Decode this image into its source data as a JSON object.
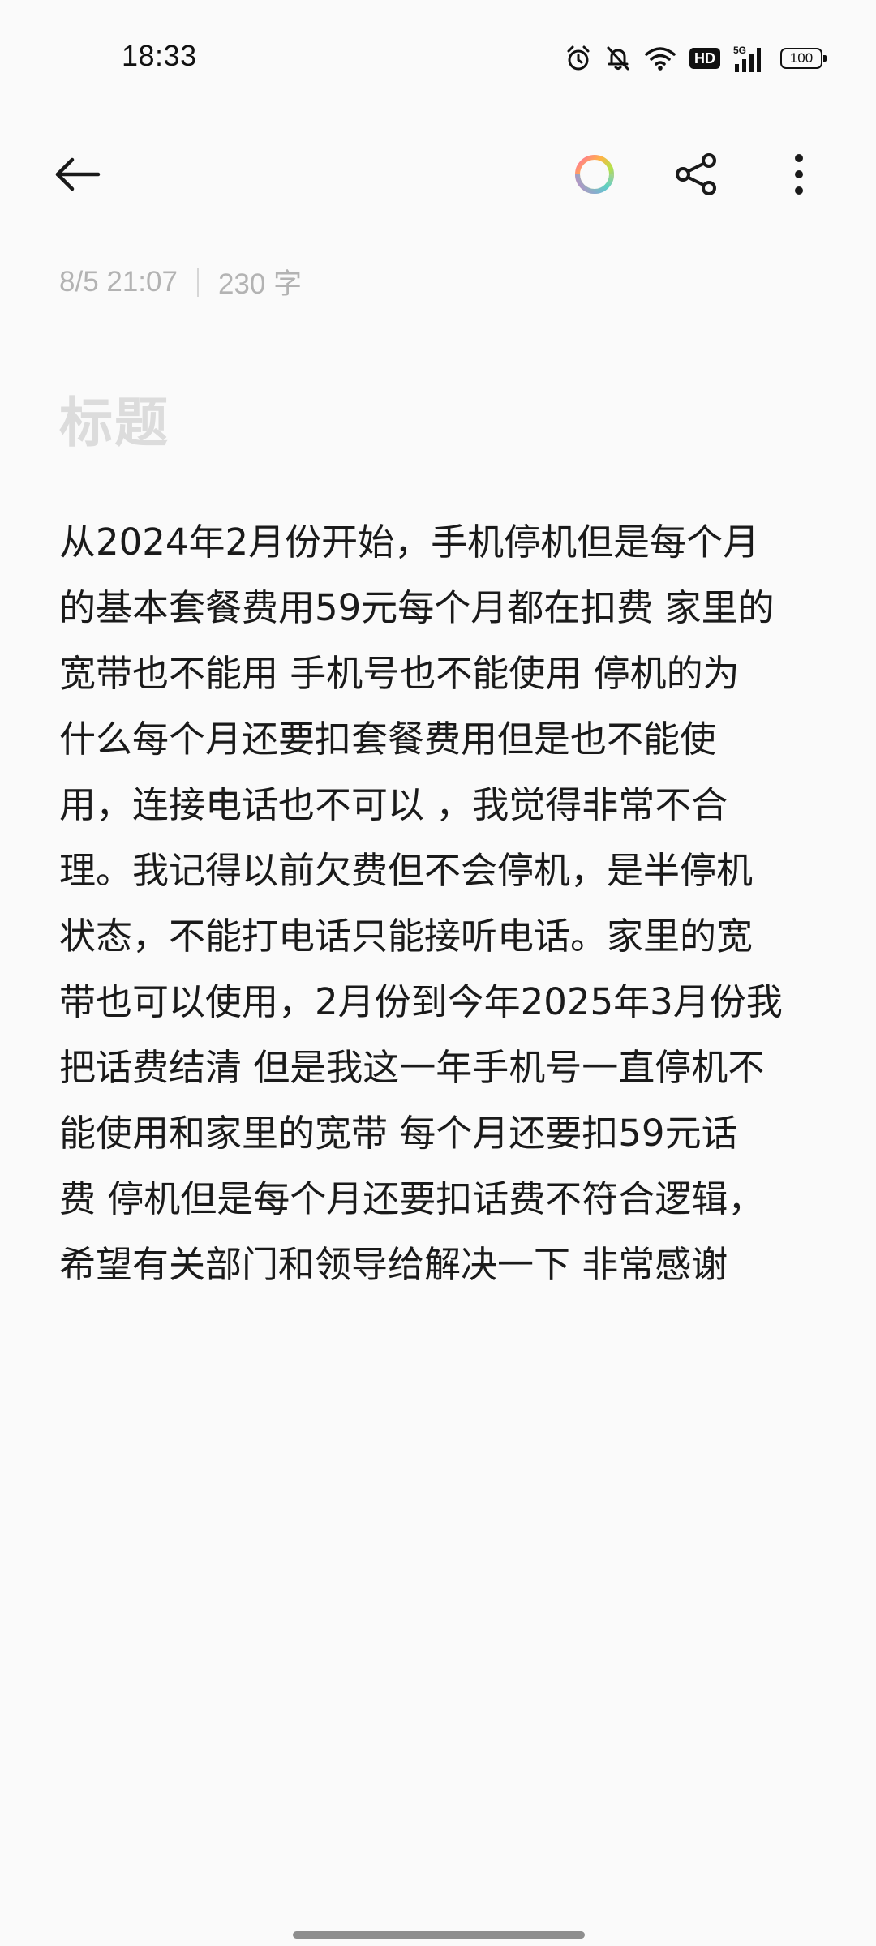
{
  "status_bar": {
    "time": "18:33",
    "hd_badge": "HD",
    "network": "5G",
    "battery": "100",
    "icons": [
      "alarm-icon",
      "silent-bell-icon",
      "wifi-icon",
      "hd-badge",
      "signal-5g-icon",
      "battery-icon"
    ]
  },
  "toolbar": {
    "back_icon": "back-arrow-icon",
    "theme_icon": "color-ring-icon",
    "share_icon": "share-icon",
    "more_icon": "more-vertical-icon"
  },
  "note": {
    "date": "8/5 21:07",
    "word_count": "230 字",
    "title_placeholder": "标题",
    "body": "从2024年2月份开始，手机停机但是每个月\n的基本套餐费用59元每个月都在扣费 家里的\n宽带也不能用 手机号也不能使用  停机的为\n什么每个月还要扣套餐费用但是也不能使\n用，连接电话也不可以 ，我觉得非常不合\n理。我记得以前欠费但不会停机，是半停机\n状态，不能打电话只能接听电话。家里的宽\n带也可以使用，2月份到今年2025年3月份我\n把话费结清 但是我这一年手机号一直停机不\n能使用和家里的宽带  每个月还要扣59元话\n费  停机但是每个月还要扣话费不符合逻辑，\n希望有关部门和领导给解决一下 非常感谢"
  },
  "colors": {
    "background": "#fafafa",
    "text": "#1a1a1a",
    "meta": "#b3b3b3",
    "title_placeholder": "#dcdcdc"
  }
}
